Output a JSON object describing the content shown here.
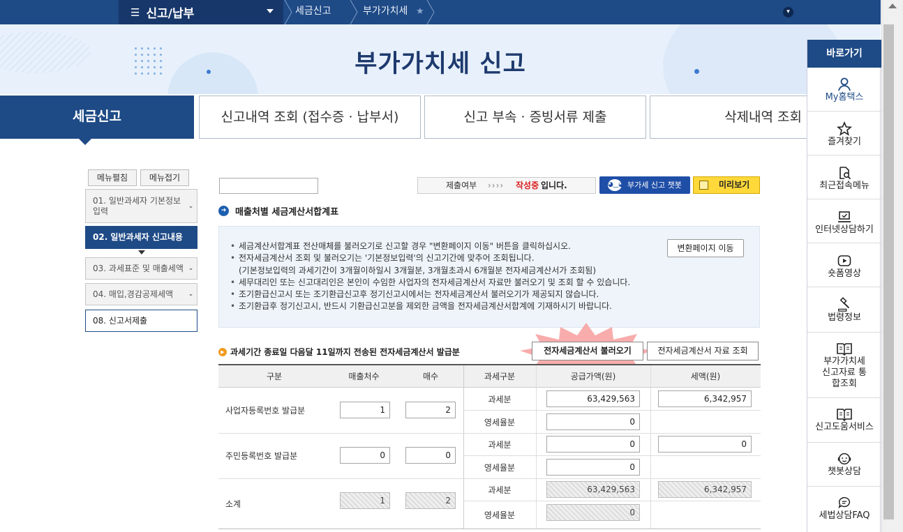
{
  "nav": {
    "menu_label": "신고/납부",
    "crumb_1": "세금신고",
    "crumb_2": "부가가치세"
  },
  "hero": {
    "title": "부가가치세 신고"
  },
  "tabs": [
    {
      "label": "세금신고"
    },
    {
      "label": "신고내역 조회 (접수증 · 납부서)"
    },
    {
      "label": "신고 부속 · 증빙서류 제출"
    },
    {
      "label": "삭제내역 조회"
    }
  ],
  "left_menu": {
    "edit_label": "메뉴펼침",
    "collapse_label": "메뉴접기",
    "steps": [
      {
        "label": "01. 일반과세자 기본정보 입력"
      },
      {
        "label": "02. 일반과세자 신고내용"
      },
      {
        "label": "03. 과세표준 및 매출세액"
      },
      {
        "label": "04. 매입,경감공제세액"
      },
      {
        "label": "08. 신고서제출"
      }
    ]
  },
  "status": {
    "label": "제출여부",
    "arrows": "››››",
    "value": "작성중",
    "suffix": "입니다."
  },
  "buttons": {
    "chatbot": "부가세 신고 챗봇",
    "preview": "미리보기",
    "convert": "변환페이지 이동",
    "fetch": "전자세금계산서 불러오기",
    "inquiry": "전자세금계산서 자료 조회"
  },
  "section_title": "매출처별 세금계산서합계표",
  "notices": [
    "세금계산서합계표 전산매체를 불러오기로 신고할 경우 \"변환페이지 이동\" 버튼을 클릭하십시오.",
    "전자세금계산서 조회 및 불러오기는 '기본정보입력'의 신고기간에 맞추어 조회됩니다.",
    "(기본정보입력의 과세기간이 3개월이하일시 3개월분, 3개월초과시 6개월분 전자세금계산서가 조회됨)",
    "세무대리인 또는 신고대리인은 본인이 수임한 사업자의 전자세금계산서 자료만 불러오기 및 조회 할 수 있습니다.",
    "조기환급신고시 또는 조기환급신고후 정기신고시에서는 전자세금계산서 불러오기가 제공되지 않습니다.",
    "조기환급후 정기신고시, 반드시 기환급신고분을 제외한 금액을 전자세금계산서합계에 기재하시기 바랍니다."
  ],
  "notice_bullet": "•",
  "sub_title": "과세기간 종료일 다음달 11일까지 전송된 전자세금계산서 발급분",
  "table": {
    "headers": [
      "구분",
      "매출처수",
      "매수",
      "과세구분",
      "공급가액(원)",
      "세액(원)"
    ],
    "rows": [
      {
        "label": "사업자등록번호 발급분",
        "clients": "1",
        "count": "2",
        "tax_label": "과세분",
        "tax_supply": "63,429,563",
        "tax_amount": "6,342,957",
        "zero_label": "영세율분",
        "zero_supply": "0"
      },
      {
        "label": "주민등록번호 발급분",
        "clients": "0",
        "count": "0",
        "tax_label": "과세분",
        "tax_supply": "0",
        "tax_amount": "0",
        "zero_label": "영세율분",
        "zero_supply": "0"
      },
      {
        "label": "소계",
        "clients": "1",
        "count": "2",
        "tax_label": "과세분",
        "tax_supply": "63,429,563",
        "tax_amount": "6,342,957",
        "zero_label": "영세율분",
        "zero_supply": "0"
      }
    ]
  },
  "quick_menu": {
    "title": "바로가기",
    "items": [
      {
        "label": "My홈택스"
      },
      {
        "label": "즐겨찾기"
      },
      {
        "label": "최근접속메뉴"
      },
      {
        "label": "인터넷상담하기"
      },
      {
        "label": "숏폼영상"
      },
      {
        "label": "법령정보"
      },
      {
        "label": "부가가치세 신고자료 통합조회"
      },
      {
        "label": "신고도움서비스"
      },
      {
        "label": "챗봇상담"
      },
      {
        "label": "세법상담FAQ"
      }
    ]
  },
  "colors": {
    "brand": "#1e4a86",
    "status_red": "#d81e1e",
    "preview_yellow": "#ffd83a",
    "highlight": "#f7a3a3"
  }
}
